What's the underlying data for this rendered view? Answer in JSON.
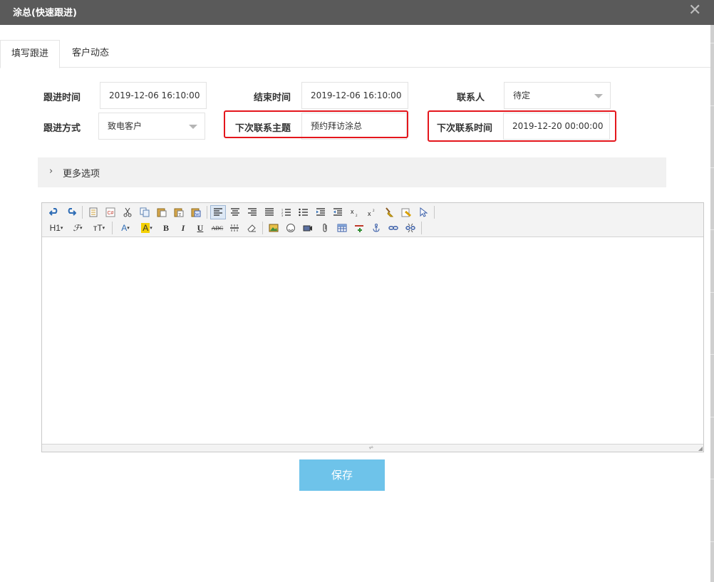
{
  "window": {
    "title": "涂总(快速跟进)",
    "close_icon": "close-icon"
  },
  "tabs": [
    {
      "label": "填写跟进",
      "active": true
    },
    {
      "label": "客户动态",
      "active": false
    }
  ],
  "form": {
    "follow_time": {
      "label": "跟进时间",
      "value": "2019-12-06 16:10:00"
    },
    "end_time": {
      "label": "结束时间",
      "value": "2019-12-06 16:10:00"
    },
    "contact": {
      "label": "联系人",
      "value": "待定"
    },
    "follow_method": {
      "label": "跟进方式",
      "value": "致电客户"
    },
    "next_subject": {
      "label": "下次联系主题",
      "value": "预约拜访涂总"
    },
    "next_time": {
      "label": "下次联系时间",
      "value": "2019-12-20 00:00:00"
    }
  },
  "more_options": {
    "label": "更多选项",
    "icon": "chevron-right-icon"
  },
  "editor": {
    "toolbar_text": {
      "h1": "H1",
      "font": "ℱ",
      "size": "тT",
      "font_color": "A",
      "bg_color": "A",
      "bold": "B",
      "italic": "I",
      "underline": "U",
      "strike": "ABC"
    },
    "content": ""
  },
  "save_button": {
    "label": "保存"
  },
  "colors": {
    "titlebar": "#5a5a5a",
    "highlight_border": "#e4161c",
    "save_button": "#6ec3ea",
    "more_bg": "#f1f1f1"
  }
}
